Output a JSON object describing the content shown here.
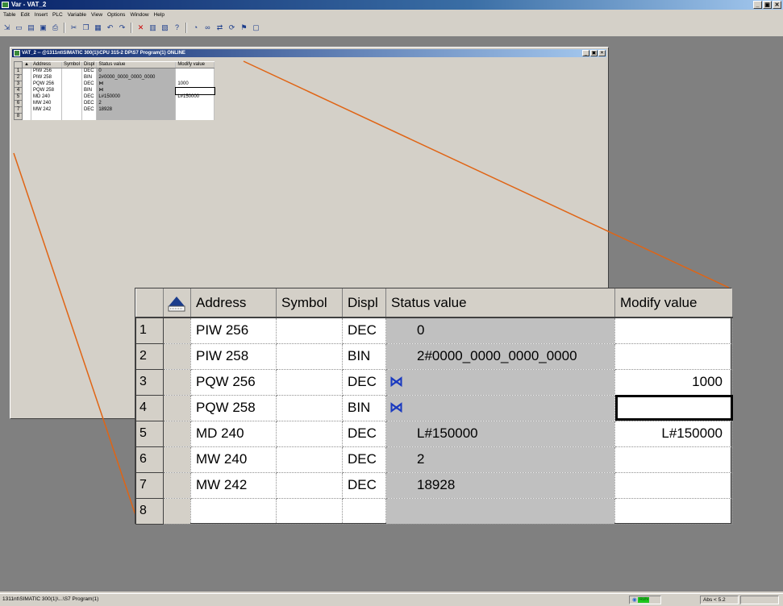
{
  "window": {
    "title": "Var - VAT_2",
    "controls": [
      "_",
      "▣",
      "✕"
    ]
  },
  "menu": [
    "Table",
    "Edit",
    "Insert",
    "PLC",
    "Variable",
    "View",
    "Options",
    "Window",
    "Help"
  ],
  "toolbar_icons": [
    "pin-icon",
    "new-icon",
    "open-icon",
    "save-icon",
    "print-icon",
    "cut-icon",
    "copy-icon",
    "paste-icon",
    "undo-icon",
    "redo-icon",
    "delete-icon",
    "monitor-icon",
    "modify-icon",
    "help-icon",
    "trigger-icon",
    "glasses-icon",
    "modify-values-icon",
    "update-icon",
    "forcing-icon",
    "stop-icon"
  ],
  "child_window": {
    "title": "VAT_2 -- @1311nt\\SIMATIC 300(1)\\CPU 315-2 DP\\S7 Program(1)  ONLINE",
    "controls": [
      "_",
      "▣",
      "✕"
    ]
  },
  "table": {
    "headers": {
      "address": "Address",
      "symbol": "Symbol",
      "display": "Displ",
      "status": "Status value",
      "modify": "Modify value"
    },
    "rows": [
      {
        "num": "1",
        "address": "PIW  256",
        "symbol": "",
        "display": "DEC",
        "status": "0",
        "status_icon": false,
        "modify": ""
      },
      {
        "num": "2",
        "address": "PIW  258",
        "symbol": "",
        "display": "BIN",
        "status": "2#0000_0000_0000_0000",
        "status_icon": false,
        "modify": ""
      },
      {
        "num": "3",
        "address": "PQW  256",
        "symbol": "",
        "display": "DEC",
        "status": "",
        "status_icon": true,
        "modify": "1000"
      },
      {
        "num": "4",
        "address": "PQW  258",
        "symbol": "",
        "display": "BIN",
        "status": "",
        "status_icon": true,
        "modify": "",
        "editing": true
      },
      {
        "num": "5",
        "address": "MD   240",
        "symbol": "",
        "display": "DEC",
        "status": "L#150000",
        "status_icon": false,
        "modify": "L#150000"
      },
      {
        "num": "6",
        "address": "MW   240",
        "symbol": "",
        "display": "DEC",
        "status": "2",
        "status_icon": false,
        "modify": ""
      },
      {
        "num": "7",
        "address": "MW   242",
        "symbol": "",
        "display": "DEC",
        "status": "18928",
        "status_icon": false,
        "modify": ""
      },
      {
        "num": "8",
        "address": "",
        "symbol": "",
        "display": "",
        "status": "",
        "status_icon": false,
        "modify": ""
      }
    ]
  },
  "statusbar": {
    "path": "1311nt\\SIMATIC 300(1)\\...\\S7 Program(1)",
    "run": "RUN",
    "mode": "Abs < 5.2"
  },
  "colors": {
    "callout": "#e06414",
    "titlebar": "#0a246a",
    "status_bg": "#c0c0c0",
    "run_led": "#1ec81e"
  }
}
